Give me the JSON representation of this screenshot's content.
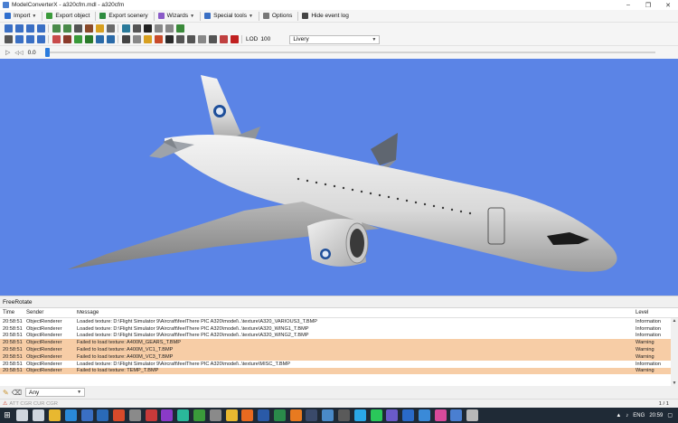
{
  "window": {
    "title": "ModelConverterX - a320cfm.mdl - a320cfm",
    "controls": [
      "–",
      "❐",
      "✕"
    ]
  },
  "menu": [
    {
      "name": "import",
      "label": "Import",
      "icon": "import-icon",
      "color": "#2f6fce",
      "dropdown": true
    },
    {
      "name": "export-object",
      "label": "Export object",
      "icon": "export-object-icon",
      "color": "#3a9a3a",
      "dropdown": false
    },
    {
      "name": "export-scenery",
      "label": "Export scenery",
      "icon": "export-scenery-icon",
      "color": "#2e8c40",
      "dropdown": false
    },
    {
      "name": "wizards",
      "label": "Wizards",
      "icon": "wizard-icon",
      "color": "#8a5ac8",
      "dropdown": true
    },
    {
      "name": "special-tools",
      "label": "Special tools",
      "icon": "special-tools-icon",
      "color": "#3a6fc4",
      "dropdown": true
    },
    {
      "name": "options",
      "label": "Options",
      "icon": "options-icon",
      "color": "#777777",
      "dropdown": false
    },
    {
      "name": "hide-event-log",
      "label": "Hide event log",
      "icon": "event-log-icon",
      "color": "#444444",
      "dropdown": false
    }
  ],
  "toolbar1": {
    "icons": [
      {
        "name": "view-front-icon",
        "color": "#3a6fc4"
      },
      {
        "name": "view-side-icon",
        "color": "#3a6fc4"
      },
      {
        "name": "view-top-icon",
        "color": "#3a6fc4"
      },
      {
        "name": "view-perspective-icon",
        "color": "#3a6fc4"
      },
      {
        "name": "zoom-in-icon",
        "color": "#4a8a4a"
      },
      {
        "name": "zoom-out-icon",
        "color": "#4a8a4a"
      },
      {
        "name": "wireframe-icon",
        "color": "#555555"
      },
      {
        "name": "normals-icon",
        "color": "#8a4a2a"
      },
      {
        "name": "lights-icon",
        "color": "#d8a020"
      },
      {
        "name": "grid-icon",
        "color": "#6a6a6a"
      },
      {
        "name": "texture-icon",
        "color": "#2a7a9a"
      },
      {
        "name": "bounding-box-icon",
        "color": "#555555"
      },
      {
        "name": "walk-icon",
        "color": "#222222"
      },
      {
        "name": "undo-icon",
        "color": "#888888"
      },
      {
        "name": "redo-icon",
        "color": "#888888"
      },
      {
        "name": "refresh-icon",
        "color": "#3a8a3a"
      }
    ]
  },
  "toolbar2": {
    "icons": [
      {
        "name": "move-icon",
        "color": "#555555"
      },
      {
        "name": "list-icon",
        "color": "#3a6fc4"
      },
      {
        "name": "grid-view-icon",
        "color": "#3a6fc4"
      },
      {
        "name": "table-icon",
        "color": "#3a6fc4"
      },
      {
        "name": "material-icon",
        "color": "#c84a4a"
      },
      {
        "name": "texture-editor-icon",
        "color": "#8a3a2a"
      },
      {
        "name": "scenery-icon",
        "color": "#3a9a3a"
      },
      {
        "name": "tree-icon",
        "color": "#2a7a2a"
      },
      {
        "name": "road-icon",
        "color": "#2a6aa8"
      },
      {
        "name": "globe-icon",
        "color": "#2a6aa8"
      },
      {
        "name": "animation-icon",
        "color": "#444444"
      },
      {
        "name": "attach-point-icon",
        "color": "#888888"
      },
      {
        "name": "sun-icon",
        "color": "#d8a020"
      },
      {
        "name": "color-icon",
        "color": "#c84a2a"
      },
      {
        "name": "camera-icon",
        "color": "#2a2a2a"
      },
      {
        "name": "effects-icon",
        "color": "#555555"
      },
      {
        "name": "collision-icon",
        "color": "#555555"
      },
      {
        "name": "lod-icon",
        "color": "#888888"
      },
      {
        "name": "gear-icon",
        "color": "#555555"
      },
      {
        "name": "bug-icon",
        "color": "#c04040"
      },
      {
        "name": "apple-icon",
        "color": "#c02020"
      }
    ],
    "lod_label": "LOD",
    "lod_value": "100",
    "livery_value": "Livery"
  },
  "timeline": {
    "play_icon": "play-icon",
    "rewind_icon": "rewind-icon",
    "value": "0.0",
    "position": 0
  },
  "panel": {
    "title": "FreeRotate"
  },
  "log": {
    "columns": [
      "Time",
      "Sender",
      "Message",
      "Level"
    ],
    "rows": [
      {
        "time": "20:58:51",
        "sender": "ObjectRenderer",
        "message": "Loaded texture: D:\\Flight Simulator 9\\Aircraft\\feelThere PIC A320\\model\\..\\texture\\A320_VARIOUS3_T.BMP",
        "level": "Information",
        "warn": false
      },
      {
        "time": "20:58:51",
        "sender": "ObjectRenderer",
        "message": "Loaded texture: D:\\Flight Simulator 9\\Aircraft\\feelThere PIC A320\\model\\..\\texture\\A320_WING1_T.BMP",
        "level": "Information",
        "warn": false
      },
      {
        "time": "20:58:51",
        "sender": "ObjectRenderer",
        "message": "Loaded texture: D:\\Flight Simulator 9\\Aircraft\\feelThere PIC A320\\model\\..\\texture\\A320_WING2_T.BMP",
        "level": "Information",
        "warn": false
      },
      {
        "time": "20:58:51",
        "sender": "ObjectRenderer",
        "message": "Failed to load texture: A400M_GEARS_T.BMP",
        "level": "Warning",
        "warn": true
      },
      {
        "time": "20:58:51",
        "sender": "ObjectRenderer",
        "message": "Failed to load texture: A400M_VC1_T.BMP",
        "level": "Warning",
        "warn": true
      },
      {
        "time": "20:58:51",
        "sender": "ObjectRenderer",
        "message": "Failed to load texture: A400M_VC3_T.BMP",
        "level": "Warning",
        "warn": true
      },
      {
        "time": "20:58:51",
        "sender": "ObjectRenderer",
        "message": "Loaded texture: D:\\Flight Simulator 9\\Aircraft\\feelThere PIC A320\\model\\..\\texture\\MISC_T.BMP",
        "level": "Information",
        "warn": false
      },
      {
        "time": "20:58:51",
        "sender": "ObjectRenderer",
        "message": "Failed to load texture: TEMP_T.BMP",
        "level": "Warning",
        "warn": true
      }
    ]
  },
  "filter": {
    "value": "Any"
  },
  "status": {
    "text": "ATT CGR  CUR CGR",
    "pages": "1 / 1"
  },
  "taskbar": {
    "apps": [
      {
        "name": "search-icon",
        "color": "#cfd6de"
      },
      {
        "name": "task-view-icon",
        "color": "#cfd6de"
      },
      {
        "name": "folder-icon",
        "color": "#e8b830"
      },
      {
        "name": "edge-icon",
        "color": "#2a8ad8"
      },
      {
        "name": "store-icon",
        "color": "#3a6fc4"
      },
      {
        "name": "mail-icon",
        "color": "#2a6ab8"
      },
      {
        "name": "media-icon",
        "color": "#d84a2a"
      },
      {
        "name": "mixer-icon",
        "color": "#8a8a8a"
      },
      {
        "name": "terminal-icon",
        "color": "#c83a3a"
      },
      {
        "name": "paint-icon",
        "color": "#8a3ac8"
      },
      {
        "name": "music-icon",
        "color": "#2ab89a"
      },
      {
        "name": "photos-icon",
        "color": "#3a9a3a"
      },
      {
        "name": "settings-icon",
        "color": "#8a8a8a"
      },
      {
        "name": "chrome-icon",
        "color": "#e8b830"
      },
      {
        "name": "firefox-icon",
        "color": "#e86a20"
      },
      {
        "name": "word-icon",
        "color": "#2a5aa8"
      },
      {
        "name": "excel-icon",
        "color": "#2a8a4a"
      },
      {
        "name": "vlc-icon",
        "color": "#e87a20"
      },
      {
        "name": "steam-icon",
        "color": "#3a4a6a"
      },
      {
        "name": "notepad-icon",
        "color": "#4a8ac8"
      },
      {
        "name": "calculator-icon",
        "color": "#5a5a5a"
      },
      {
        "name": "skype-icon",
        "color": "#2aa8e8"
      },
      {
        "name": "spotify-icon",
        "color": "#2ac85a"
      },
      {
        "name": "teams-icon",
        "color": "#6a5ac8"
      },
      {
        "name": "outlook-icon",
        "color": "#2a6ac8"
      },
      {
        "name": "onedrive-icon",
        "color": "#3a8ad8"
      },
      {
        "name": "paint3d-icon",
        "color": "#d84a9a"
      },
      {
        "name": "modelconverterx-icon",
        "color": "#4a7fd1"
      },
      {
        "name": "flight-sim-icon",
        "color": "#b8b8b8"
      }
    ],
    "language": "ENG",
    "clock": "20:59"
  },
  "colors": {
    "viewport_bg": "#5b84e6",
    "warning_row": "#f7cda6",
    "taskbar_bg": "#1f2a36"
  }
}
